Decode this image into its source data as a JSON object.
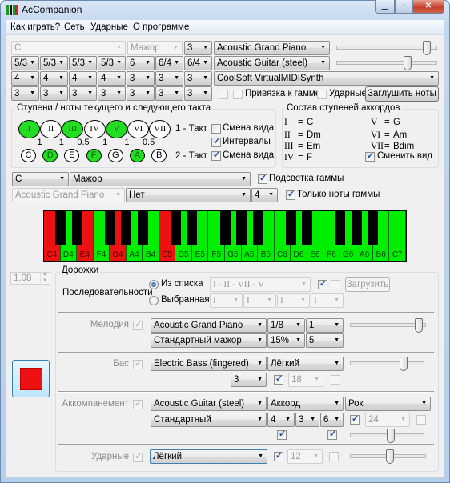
{
  "window": {
    "title": "AcCompanion",
    "minimize_icon": "▁",
    "maximize_icon": "▫",
    "close_icon": "✕"
  },
  "menu": {
    "items": [
      "Как играть?",
      "Сеть",
      "Ударные",
      "О программе"
    ]
  },
  "top": {
    "key": "C",
    "mode": "Мажор",
    "octave": "3",
    "instrument_1": "Acoustic Grand Piano",
    "volume_1": 0.93,
    "instrument_2": "Acoustic Guitar (steel)",
    "volume_2": 0.72,
    "synth": "CoolSoft VirtualMIDISynth",
    "row_inversions": [
      "5/3",
      "5/3",
      "5/3",
      "5/3",
      "6",
      "6/4",
      "6/4"
    ],
    "row_3": [
      "4",
      "4",
      "4",
      "4",
      "3",
      "3",
      "3"
    ],
    "row_4": [
      "3",
      "3",
      "3",
      "3",
      "3",
      "3",
      "3"
    ],
    "option_unlabeled": {
      "checked": false
    },
    "snap_to_scale": {
      "label": "Привязка к гамме",
      "checked": false
    },
    "drums": {
      "label": "Ударные",
      "checked": false
    },
    "mute_button": "Заглушить ноты"
  },
  "degrees_group": {
    "title": "Ступени / ноты текущего и следующего такта",
    "degrees": [
      {
        "label": "I",
        "active": true
      },
      {
        "label": "II",
        "active": false
      },
      {
        "label": "III",
        "active": true
      },
      {
        "label": "IV",
        "active": false
      },
      {
        "label": "V",
        "active": true
      },
      {
        "label": "VI",
        "active": false
      },
      {
        "label": "VII",
        "active": false
      }
    ],
    "intervals": [
      "1",
      "1",
      "0.5",
      "1",
      "1",
      "0.5"
    ],
    "notes": [
      {
        "label": "C",
        "active": false
      },
      {
        "label": "D",
        "active": true
      },
      {
        "label": "E",
        "active": false
      },
      {
        "label": "F",
        "active": true
      },
      {
        "label": "G",
        "active": false
      },
      {
        "label": "A",
        "active": true
      },
      {
        "label": "B",
        "active": false
      }
    ],
    "bar1_label": "1 - Такт",
    "bar2_label": "2 - Такт",
    "bar1_toggle": {
      "label": "Смена вида",
      "checked": false
    },
    "intervals_toggle": {
      "label": "Интервалы",
      "checked": true
    },
    "bar2_toggle": {
      "label": "Смена вида",
      "checked": true
    }
  },
  "chords_group": {
    "title": "Состав ступеней аккордов",
    "eq": "=",
    "chords": [
      {
        "degree": "I",
        "chord": "C"
      },
      {
        "degree": "II",
        "chord": "Dm"
      },
      {
        "degree": "III",
        "chord": "Em"
      },
      {
        "degree": "IV",
        "chord": "F"
      },
      {
        "degree": "V",
        "chord": "G"
      },
      {
        "degree": "VI",
        "chord": "Am"
      },
      {
        "degree": "VII",
        "chord": "Bdim"
      }
    ],
    "toggle": {
      "label": "Сменить вид",
      "checked": true
    }
  },
  "scale": {
    "key": "C",
    "mode": "Мажор",
    "highlight": {
      "label": "Подсветка гаммы",
      "checked": true
    },
    "instrument": "Acoustic Grand Piano",
    "variant": "Нет",
    "octaves": "4",
    "only_scale": {
      "label": "Только ноты гаммы",
      "checked": true
    }
  },
  "piano": {
    "colors": {
      "chord": "#ee1111",
      "scale": "#00ee00"
    },
    "keys": [
      {
        "note": "C4",
        "state": "chord"
      },
      {
        "note": "D4",
        "state": "scale"
      },
      {
        "note": "E4",
        "state": "chord"
      },
      {
        "note": "F4",
        "state": "scale"
      },
      {
        "note": "G4",
        "state": "chord"
      },
      {
        "note": "A4",
        "state": "scale"
      },
      {
        "note": "B4",
        "state": "scale"
      },
      {
        "note": "C5",
        "state": "chord"
      },
      {
        "note": "D5",
        "state": "scale"
      },
      {
        "note": "E5",
        "state": "scale"
      },
      {
        "note": "F5",
        "state": "scale"
      },
      {
        "note": "G5",
        "state": "scale"
      },
      {
        "note": "A5",
        "state": "scale"
      },
      {
        "note": "B5",
        "state": "scale"
      },
      {
        "note": "C6",
        "state": "scale"
      },
      {
        "note": "D6",
        "state": "scale"
      },
      {
        "note": "E6",
        "state": "scale"
      },
      {
        "note": "F6",
        "state": "scale"
      },
      {
        "note": "G6",
        "state": "scale"
      },
      {
        "note": "A6",
        "state": "scale"
      },
      {
        "note": "B6",
        "state": "scale"
      },
      {
        "note": "C7",
        "state": "scale"
      }
    ]
  },
  "tempo": "1,08",
  "tracks": {
    "title": "Дорожки",
    "sequences_label": "Последовательности",
    "from_list": {
      "label": "Из списка",
      "selected": true
    },
    "selected": {
      "label": "Выбранная",
      "selected": false
    },
    "sequence": "I - II - VII - V",
    "seq_check_1": true,
    "seq_check_2": false,
    "load_button": "Загрузить",
    "custom_degrees": [
      "I",
      "I",
      "I",
      "I"
    ],
    "melody": {
      "label": "Мелодия",
      "enabled": true,
      "instrument": "Acoustic Grand Piano",
      "duration": "1/8",
      "value": "1",
      "style": "Стандартный мажор",
      "percent": "15%",
      "value2": "5",
      "volume": 0.95
    },
    "bass": {
      "label": "Бас",
      "enabled": true,
      "instrument": "Electric Bass (fingered)",
      "style": "Лёгкий",
      "octave": "3",
      "check_1": true,
      "value": "18",
      "check_2": false,
      "volume": 0.75
    },
    "accomp": {
      "label": "Аккомпанемент",
      "enabled": true,
      "instrument": "Acoustic Guitar (steel)",
      "type": "Аккорд",
      "genre": "Рок",
      "style": "Стандартный",
      "v1": "4",
      "v2": "3",
      "v3": "6",
      "check_1": true,
      "value": "24",
      "check_2": false,
      "check_3": true,
      "check_4": true,
      "volume": 0.55
    },
    "drums": {
      "label": "Ударные",
      "enabled": true,
      "style": "Лёгкий",
      "check_1": true,
      "value": "12",
      "check_2": false,
      "volume": 0.53
    }
  }
}
